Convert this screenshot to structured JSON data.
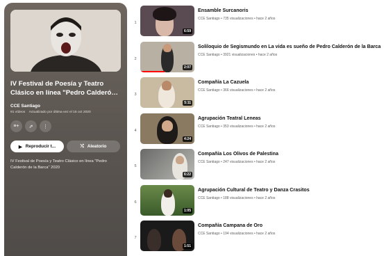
{
  "playlist": {
    "title": "IV Festival de Poesía y Teatro Clásico en línea \"Pedro Calderón d...",
    "owner": "CCE Santiago",
    "video_count": "91 vídeos",
    "updated": "Actualizado por última vez el 15 oct 2020",
    "play_label": "Reproducir t...",
    "shuffle_label": "Aleatorio",
    "description": "IV Festival de Poesía y Teatro Clásico en línea \"Pedro Calderón de la Barca\" 2020",
    "icons": [
      "add-to-library-icon",
      "share-icon",
      "more-options-icon",
      "play-icon",
      "shuffle-icon"
    ]
  },
  "videos": [
    {
      "index": "1",
      "title": "Ensamble Surcanoris",
      "channel": "CCE Santiago",
      "views": "735 visualizaciones",
      "age": "hace 2 años",
      "duration": "6:59",
      "bg": "#5a4a52"
    },
    {
      "index": "2",
      "title": "Soliloquio de Segismundo en La vida es sueño de Pedro Calderón de la Barca",
      "channel": "CCE Santiago",
      "views": "3921 visualizaciones",
      "age": "hace 2 años",
      "duration": "2:07",
      "bg": "#b8b0a2",
      "progress": 0.45
    },
    {
      "index": "3",
      "title": "Compañía La Cazuela",
      "channel": "CCE Santiago",
      "views": "366 visualizaciones",
      "age": "hace 2 años",
      "duration": "5:11",
      "bg": "#c9bba2"
    },
    {
      "index": "4",
      "title": "Agrupación Teatral Leneas",
      "channel": "CCE Santiago",
      "views": "353 visualizaciones",
      "age": "hace 2 años",
      "duration": "4:24",
      "bg": "#8a7a62"
    },
    {
      "index": "5",
      "title": "Compañía Los Olivos de Palestina",
      "channel": "CCE Santiago",
      "views": "247 visualizaciones",
      "age": "hace 2 años",
      "duration": "6:22",
      "bg": "#9a9a98"
    },
    {
      "index": "6",
      "title": "Agrupación Cultural de Teatro y Danza Crasitos",
      "channel": "CCE Santiago",
      "views": "188 visualizaciones",
      "age": "hace 2 años",
      "duration": "1:05",
      "bg": "#4a6a3a"
    },
    {
      "index": "7",
      "title": "Compañía Campana de Oro",
      "channel": "CCE Santiago",
      "views": "194 visualizaciones",
      "age": "hace 2 años",
      "duration": "1:51",
      "bg": "#1a1a1a"
    }
  ],
  "colors": {
    "accent": "#ff0000",
    "panel": "#5e5853"
  }
}
